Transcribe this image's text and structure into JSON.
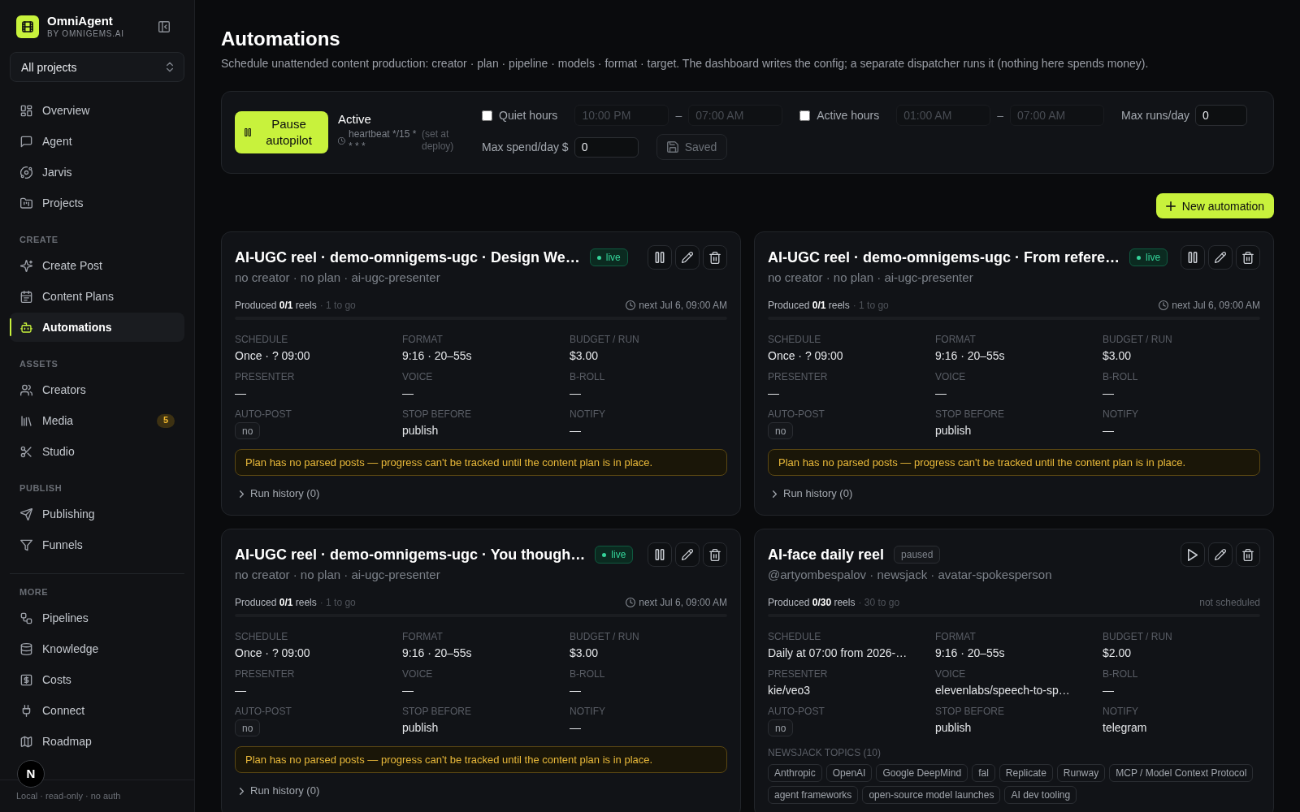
{
  "sidebar": {
    "brand": {
      "name": "OmniAgent",
      "tagline": "BY OMNIGEMS.AI"
    },
    "project_selector": {
      "value": "All projects"
    },
    "sections": [
      {
        "divider": false,
        "items": [
          {
            "label": "Overview",
            "selected": false
          },
          {
            "label": "Agent",
            "selected": false
          },
          {
            "label": "Jarvis",
            "selected": false
          },
          {
            "label": "Projects",
            "selected": false
          }
        ]
      },
      {
        "label": "CREATE",
        "divider": false,
        "items": [
          {
            "label": "Create Post",
            "selected": false
          },
          {
            "label": "Content Plans",
            "selected": false
          },
          {
            "label": "Automations",
            "selected": true
          }
        ]
      },
      {
        "label": "ASSETS",
        "divider": false,
        "items": [
          {
            "label": "Creators",
            "selected": false
          },
          {
            "label": "Media",
            "selected": false,
            "badge": "5"
          },
          {
            "label": "Studio",
            "selected": false
          }
        ]
      },
      {
        "label": "PUBLISH",
        "divider": false,
        "items": [
          {
            "label": "Publishing",
            "selected": false
          },
          {
            "label": "Funnels",
            "selected": false
          }
        ]
      },
      {
        "label": "MORE",
        "divider": true,
        "items": [
          {
            "label": "Pipelines",
            "selected": false
          },
          {
            "label": "Knowledge",
            "selected": false
          },
          {
            "label": "Costs",
            "selected": false
          },
          {
            "label": "Connect",
            "selected": false
          },
          {
            "label": "Roadmap",
            "selected": false
          }
        ]
      }
    ],
    "footer": "Local · read-only · no auth"
  },
  "dev_indicator": {
    "label": "N"
  },
  "header": {
    "title": "Automations",
    "description": "Schedule unattended content production: creator · plan · pipeline · models · format · target. The dashboard writes the config; a separate dispatcher runs it (nothing here spends money)."
  },
  "autopilot": {
    "button": "Pause autopilot",
    "status": "Active",
    "heartbeat": "heartbeat */15 * * * *",
    "note": "(set at deploy)"
  },
  "quiet_hours": {
    "label": "Quiet hours",
    "checked": false,
    "from": "10:00 PM",
    "separator": "–",
    "to": "07:00 AM"
  },
  "active_hours": {
    "label": "Active hours",
    "checked": false,
    "from": "01:00 AM",
    "separator": "–",
    "to": "07:00 AM"
  },
  "max_runs": {
    "label": "Max runs/day",
    "value": "0"
  },
  "max_spend": {
    "label": "Max spend/day $",
    "value": "0"
  },
  "save_button": {
    "label": "Saved",
    "disabled": true
  },
  "new_automation_button": "New automation",
  "automations": [
    {
      "title": "AI-UGC reel · demo-omnigems-ugc · Design We…",
      "status": {
        "kind": "live",
        "label": "live"
      },
      "subtitle": "no creator · no plan · ai-ugc-presenter",
      "progress": {
        "text": "Produced **0/1** reels",
        "remaining": "· 1 to go",
        "level": 0
      },
      "next_run": {
        "kind": "scheduled",
        "text": "next Jul 6, 09:00 AM"
      },
      "fields": [
        {
          "label": "SCHEDULE",
          "value": "Once · ? 09:00",
          "kind": "text"
        },
        {
          "label": "FORMAT",
          "value": "9:16 · 20–55s",
          "kind": "text"
        },
        {
          "label": "BUDGET / RUN",
          "value": "$3.00",
          "kind": "text"
        },
        {
          "label": "PRESENTER",
          "value": "—",
          "kind": "text"
        },
        {
          "label": "VOICE",
          "value": "—",
          "kind": "text"
        },
        {
          "label": "B-ROLL",
          "value": "—",
          "kind": "text"
        },
        {
          "label": "AUTO-POST",
          "value": "no",
          "kind": "chip"
        },
        {
          "label": "STOP BEFORE",
          "value": "publish",
          "kind": "text"
        },
        {
          "label": "NOTIFY",
          "value": "—",
          "kind": "text"
        }
      ],
      "warning": "Plan has no parsed posts — progress can't be tracked until the content plan is in place.",
      "run_history": "Run history (0)"
    },
    {
      "title": "AI-UGC reel · demo-omnigems-ugc · From refere…",
      "status": {
        "kind": "live",
        "label": "live"
      },
      "subtitle": "no creator · no plan · ai-ugc-presenter",
      "progress": {
        "text": "Produced **0/1** reels",
        "remaining": "· 1 to go",
        "level": 0
      },
      "next_run": {
        "kind": "scheduled",
        "text": "next Jul 6, 09:00 AM"
      },
      "fields": [
        {
          "label": "SCHEDULE",
          "value": "Once · ? 09:00",
          "kind": "text"
        },
        {
          "label": "FORMAT",
          "value": "9:16 · 20–55s",
          "kind": "text"
        },
        {
          "label": "BUDGET / RUN",
          "value": "$3.00",
          "kind": "text"
        },
        {
          "label": "PRESENTER",
          "value": "—",
          "kind": "text"
        },
        {
          "label": "VOICE",
          "value": "—",
          "kind": "text"
        },
        {
          "label": "B-ROLL",
          "value": "—",
          "kind": "text"
        },
        {
          "label": "AUTO-POST",
          "value": "no",
          "kind": "chip"
        },
        {
          "label": "STOP BEFORE",
          "value": "publish",
          "kind": "text"
        },
        {
          "label": "NOTIFY",
          "value": "—",
          "kind": "text"
        }
      ],
      "warning": "Plan has no parsed posts — progress can't be tracked until the content plan is in place.",
      "run_history": "Run history (0)"
    },
    {
      "title": "AI-UGC reel · demo-omnigems-ugc · You though…",
      "status": {
        "kind": "live",
        "label": "live"
      },
      "subtitle": "no creator · no plan · ai-ugc-presenter",
      "progress": {
        "text": "Produced **0/1** reels",
        "remaining": "· 1 to go",
        "level": 0
      },
      "next_run": {
        "kind": "scheduled",
        "text": "next Jul 6, 09:00 AM"
      },
      "fields": [
        {
          "label": "SCHEDULE",
          "value": "Once · ? 09:00",
          "kind": "text"
        },
        {
          "label": "FORMAT",
          "value": "9:16 · 20–55s",
          "kind": "text"
        },
        {
          "label": "BUDGET / RUN",
          "value": "$3.00",
          "kind": "text"
        },
        {
          "label": "PRESENTER",
          "value": "—",
          "kind": "text"
        },
        {
          "label": "VOICE",
          "value": "—",
          "kind": "text"
        },
        {
          "label": "B-ROLL",
          "value": "—",
          "kind": "text"
        },
        {
          "label": "AUTO-POST",
          "value": "no",
          "kind": "chip"
        },
        {
          "label": "STOP BEFORE",
          "value": "publish",
          "kind": "text"
        },
        {
          "label": "NOTIFY",
          "value": "—",
          "kind": "text"
        }
      ],
      "warning": "Plan has no parsed posts — progress can't be tracked until the content plan is in place.",
      "run_history": "Run history (0)"
    },
    {
      "title": "AI-face daily reel",
      "status": {
        "kind": "paused",
        "label": "paused"
      },
      "subtitle": "@artyombespalov · newsjack · avatar-spokesperson",
      "progress": {
        "text": "Produced **0/30** reels",
        "remaining": "· 30 to go",
        "level": 0
      },
      "next_run": {
        "kind": "unscheduled",
        "text": "not scheduled"
      },
      "fields": [
        {
          "label": "SCHEDULE",
          "value": "Daily at 07:00 from 2026-…",
          "kind": "text"
        },
        {
          "label": "FORMAT",
          "value": "9:16 · 20–55s",
          "kind": "text"
        },
        {
          "label": "BUDGET / RUN",
          "value": "$2.00",
          "kind": "text"
        },
        {
          "label": "PRESENTER",
          "value": "kie/veo3",
          "kind": "text"
        },
        {
          "label": "VOICE",
          "value": "elevenlabs/speech-to-sp…",
          "kind": "text"
        },
        {
          "label": "B-ROLL",
          "value": "—",
          "kind": "text"
        },
        {
          "label": "AUTO-POST",
          "value": "no",
          "kind": "chip"
        },
        {
          "label": "STOP BEFORE",
          "value": "publish",
          "kind": "text"
        },
        {
          "label": "NOTIFY",
          "value": "telegram",
          "kind": "text"
        }
      ],
      "topics": {
        "label": "NEWSJACK TOPICS (10)",
        "items": [
          "Anthropic",
          "OpenAI",
          "Google DeepMind",
          "fal",
          "Replicate",
          "Runway",
          "MCP / Model Context Protocol",
          "agent frameworks",
          "open-source model launches",
          "AI dev tooling"
        ]
      }
    }
  ]
}
